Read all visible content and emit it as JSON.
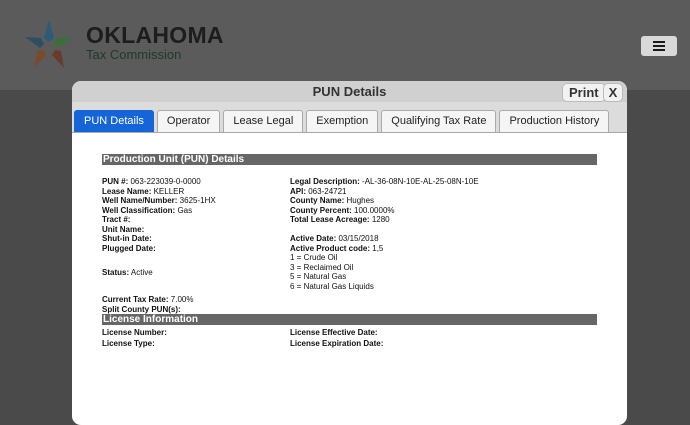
{
  "brand": {
    "name": "OKLAHOMA",
    "sub": "Tax Commission"
  },
  "modal": {
    "title": "PUN Details",
    "print_label": "Print",
    "close_label": "X",
    "tabs": [
      "PUN Details",
      "Operator",
      "Lease Legal",
      "Exemption",
      "Qualifying Tax Rate",
      "Production History"
    ]
  },
  "pun": {
    "section_title": "Production Unit (PUN) Details",
    "pun_label": "PUN #:",
    "pun_value": "063-223039-0-0000",
    "lease_name_label": "Lease Name:",
    "lease_name_value": "KELLER",
    "well_label": "Well Name/Number:",
    "well_value": "3625-1HX",
    "class_label": "Well Classification:",
    "class_value": "Gas",
    "tract_label": "Tract #:",
    "unit_label": "Unit Name:",
    "shutin_label": "Shut-in Date:",
    "plugged_label": "Plugged Date:",
    "status_label": "Status:",
    "status_value": "Active",
    "taxrate_label": "Current Tax Rate:",
    "taxrate_value": "7.00%",
    "split_label": "Split County PUN(s):",
    "legal_label": "Legal Description:",
    "legal_value": "-AL-36-08N-10E-AL-25-08N-10E",
    "api_label": "API:",
    "api_value": "063-24721",
    "county_label": "County Name:",
    "county_value": "Hughes",
    "percent_label": "County Percent:",
    "percent_value": "100.0000%",
    "acreage_label": "Total Lease Acreage:",
    "acreage_value": "1280",
    "active_date_label": "Active Date:",
    "active_date_value": "03/15/2018",
    "product_label": "Active Product code:",
    "product_value": "1,5",
    "codes": [
      "1 = Crude Oil",
      "3 = Reclaimed Oil",
      "5 = Natural Gas",
      "6 = Natural Gas Liquids"
    ]
  },
  "license": {
    "section_title": "License Information",
    "number_label": "License Number:",
    "type_label": "License Type:",
    "effective_label": "License Effective Date:",
    "expiration_label": "License Expiration Date:"
  }
}
